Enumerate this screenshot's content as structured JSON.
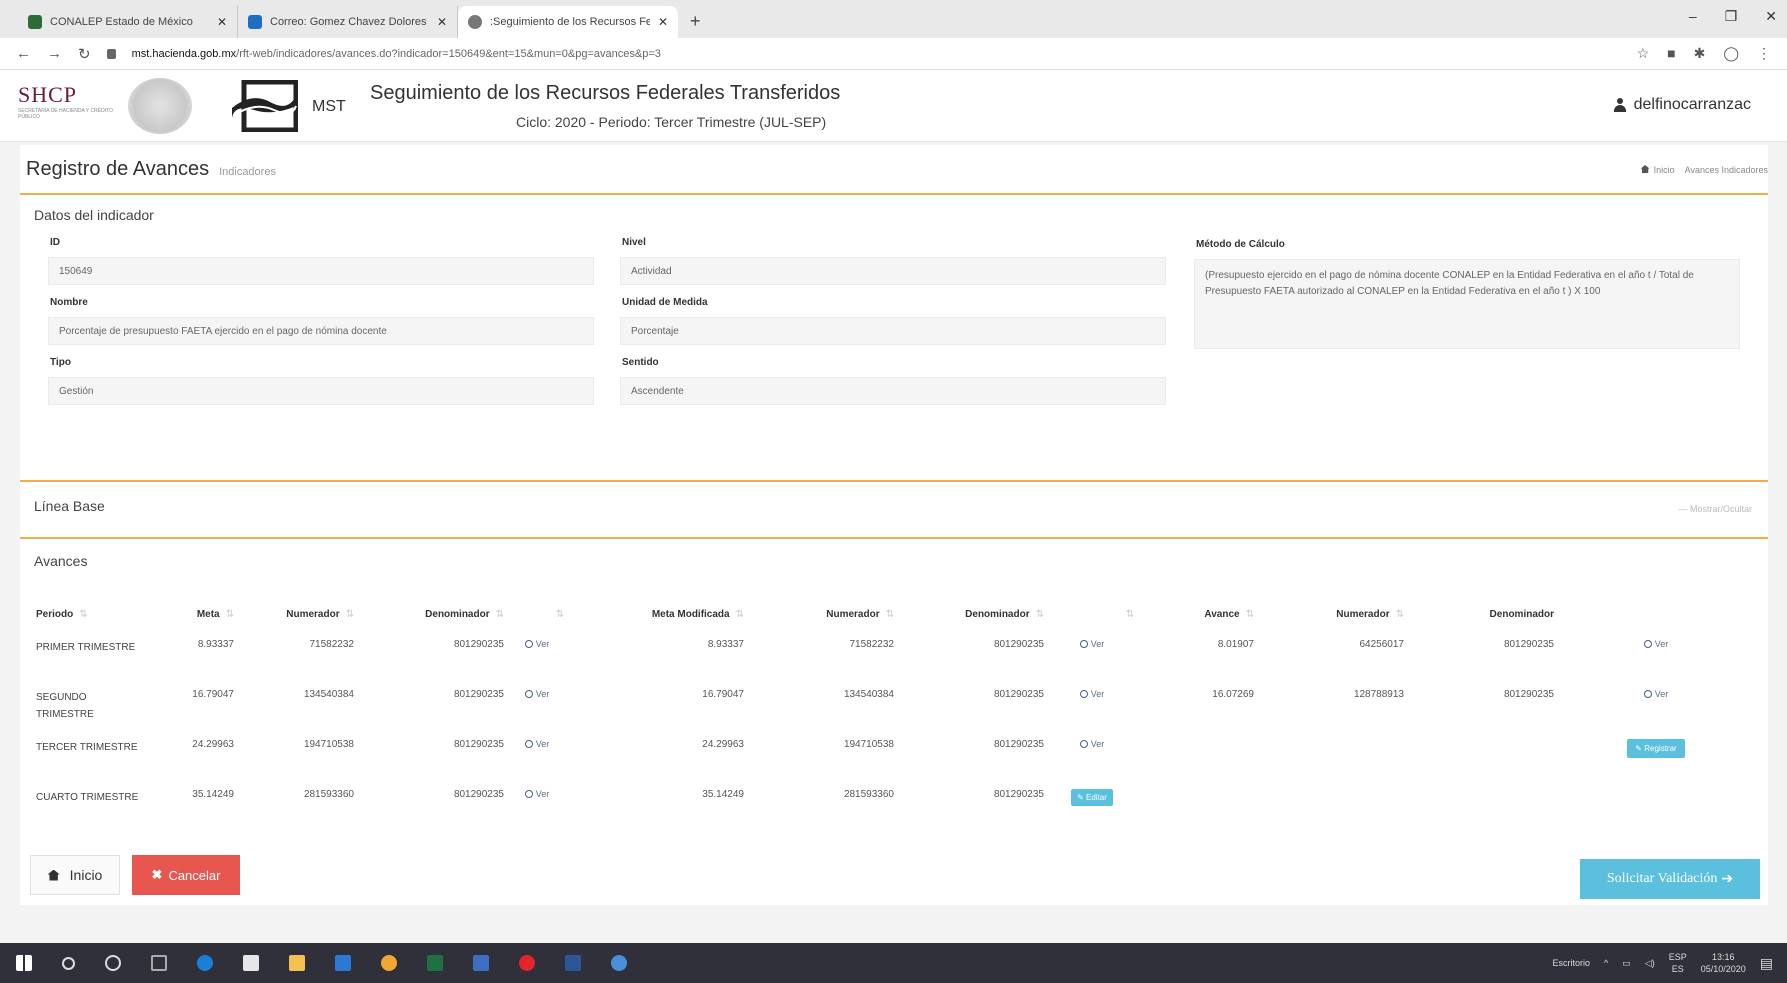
{
  "browser": {
    "tabs": [
      {
        "title": "CONALEP Estado de México",
        "color": "#2d6b3a"
      },
      {
        "title": "Correo: Gomez Chavez Dolores",
        "color": "#1e6fc1"
      },
      {
        "title": ":Seguimiento de los Recursos Fe",
        "color": "#777777"
      }
    ],
    "url_host": "mst.hacienda.gob.mx",
    "url_path": "/rft-web/indicadores/avances.do?indicador=150649&ent=15&mun=0&pg=avances&p=3"
  },
  "header": {
    "shcp": "SHCP",
    "shcp_small": "SECRETARÍA DE HACIENDA Y CRÉDITO PÚBLICO",
    "mst": "MST",
    "title": "Seguimiento de los Recursos Federales Transferidos",
    "subtitle": "Ciclo: 2020 - Periodo: Tercer Trimestre (JUL-SEP)",
    "user": "delfinocarranzac"
  },
  "page": {
    "title": "Registro de Avances",
    "subtitle": "Indicadores",
    "breadcrumb_home": "Inicio",
    "breadcrumb_current": "Avances Indicadores"
  },
  "datos": {
    "section_title": "Datos del indicador",
    "id_label": "ID",
    "id_value": "150649",
    "nombre_label": "Nombre",
    "nombre_value": "Porcentaje de presupuesto FAETA ejercido en el pago de nómina docente",
    "tipo_label": "Tipo",
    "tipo_value": "Gestión",
    "nivel_label": "Nivel",
    "nivel_value": "Actividad",
    "unidad_label": "Unidad de Medida",
    "unidad_value": "Porcentaje",
    "sentido_label": "Sentido",
    "sentido_value": "Ascendente",
    "metodo_label": "Método de Cálculo",
    "metodo_value": "(Presupuesto ejercido en el pago de nómina docente CONALEP en la Entidad Federativa en el año t / Total de Presupuesto FAETA autorizado al CONALEP en la Entidad Federativa en el año t ) X 100"
  },
  "linea_base": {
    "title": "Línea Base",
    "right_text": "— Mostrar/Ocultar"
  },
  "avances": {
    "title": "Avances",
    "headers": [
      "Periodo",
      "Meta",
      "Numerador",
      "Denominador",
      "",
      "Meta Modificada",
      "Numerador",
      "Denominador",
      "",
      "Avance",
      "Numerador",
      "Denominador",
      ""
    ],
    "ver_label": "Ver",
    "editar_label": "Editar",
    "registrar_label": "Registrar",
    "rows": [
      {
        "periodo": "PRIMER TRIMESTRE",
        "meta": "8.93337",
        "num1": "71582232",
        "den1": "801290235",
        "meta_mod": "8.93337",
        "num2": "71582232",
        "den2": "801290235",
        "avance": "8.01907",
        "num3": "64256017",
        "den3": "801290235"
      },
      {
        "periodo": "SEGUNDO TRIMESTRE",
        "meta": "16.79047",
        "num1": "134540384",
        "den1": "801290235",
        "meta_mod": "16.79047",
        "num2": "134540384",
        "den2": "801290235",
        "avance": "16.07269",
        "num3": "128788913",
        "den3": "801290235"
      },
      {
        "periodo": "TERCER TRIMESTRE",
        "meta": "24.29963",
        "num1": "194710538",
        "den1": "801290235",
        "meta_mod": "24.29963",
        "num2": "194710538",
        "den2": "801290235",
        "avance": "",
        "num3": "",
        "den3": ""
      },
      {
        "periodo": "CUARTO TRIMESTRE",
        "meta": "35.14249",
        "num1": "281593360",
        "den1": "801290235",
        "meta_mod": "35.14249",
        "num2": "281593360",
        "den2": "801290235",
        "avance": "",
        "num3": "",
        "den3": ""
      }
    ]
  },
  "buttons": {
    "inicio": "Inicio",
    "cancelar": "Cancelar",
    "solicitar": "Solicitar Validación"
  },
  "taskbar": {
    "search_text": "Escritorio",
    "lang": "ESP",
    "lang2": "ES",
    "time": "13:16",
    "date": "05/10/2020"
  }
}
